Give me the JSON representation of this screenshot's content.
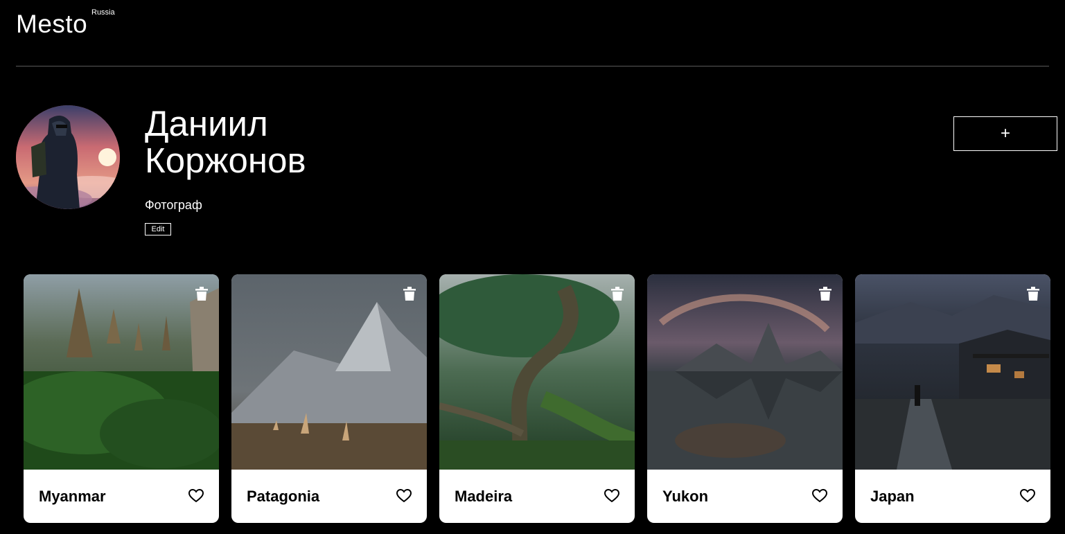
{
  "header": {
    "logo": "Mesto",
    "logo_sup": "Russia"
  },
  "profile": {
    "name": "Даниил Коржонов",
    "job": "Фотограф",
    "edit_label": "Edit",
    "add_label": "+"
  },
  "cards": [
    {
      "title": "Myanmar",
      "icon_like": "heart-icon",
      "icon_delete": "trash-icon"
    },
    {
      "title": "Patagonia",
      "icon_like": "heart-icon",
      "icon_delete": "trash-icon"
    },
    {
      "title": "Madeira",
      "icon_like": "heart-icon",
      "icon_delete": "trash-icon"
    },
    {
      "title": "Yukon",
      "icon_like": "heart-icon",
      "icon_delete": "trash-icon"
    },
    {
      "title": "Japan",
      "icon_like": "heart-icon",
      "icon_delete": "trash-icon"
    }
  ],
  "colors": {
    "background": "#000000",
    "text": "#ffffff",
    "card_bg": "#ffffff",
    "card_title": "#000000"
  }
}
